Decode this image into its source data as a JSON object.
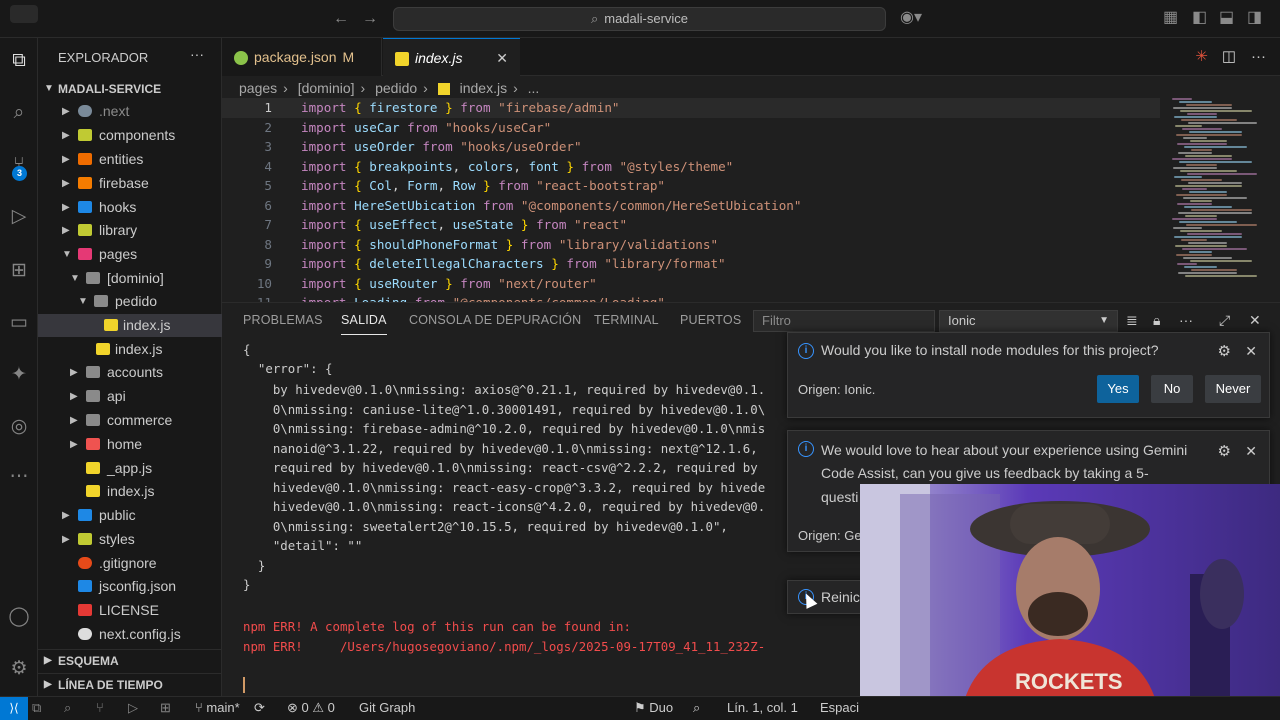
{
  "titlebar": {
    "search_text": "madali-service"
  },
  "activity_bar": {
    "scm_badge": "3"
  },
  "sidebar": {
    "title": "EXPLORADOR",
    "root": "MADALI-SERVICE",
    "items": [
      {
        "label": ".next"
      },
      {
        "label": "components"
      },
      {
        "label": "entities"
      },
      {
        "label": "firebase"
      },
      {
        "label": "hooks"
      },
      {
        "label": "library"
      },
      {
        "label": "pages"
      },
      {
        "label": "[dominio]"
      },
      {
        "label": "pedido"
      },
      {
        "label": "index.js"
      },
      {
        "label": "index.js"
      },
      {
        "label": "accounts"
      },
      {
        "label": "api"
      },
      {
        "label": "commerce"
      },
      {
        "label": "home"
      },
      {
        "label": "_app.js"
      },
      {
        "label": "index.js"
      },
      {
        "label": "public"
      },
      {
        "label": "styles"
      },
      {
        "label": ".gitignore"
      },
      {
        "label": "jsconfig.json"
      },
      {
        "label": "LICENSE"
      },
      {
        "label": "next.config.js"
      }
    ],
    "sections": [
      "ESQUEMA",
      "LÍNEA DE TIEMPO"
    ]
  },
  "tabs": [
    {
      "label": "package.json",
      "modified": "M"
    },
    {
      "label": "index.js"
    }
  ],
  "breadcrumb": [
    "pages",
    "[dominio]",
    "pedido",
    "index.js",
    "..."
  ],
  "editor": {
    "lines": [
      {
        "n": "1",
        "parts": [
          [
            "k",
            "import "
          ],
          [
            "p",
            "{ "
          ],
          [
            "v",
            "firestore"
          ],
          [
            "p",
            " } "
          ],
          [
            "k",
            "from "
          ],
          [
            "s",
            "\"firebase/admin\""
          ]
        ]
      },
      {
        "n": "2",
        "parts": [
          [
            "k",
            "import "
          ],
          [
            "v",
            "useCar "
          ],
          [
            "k",
            "from "
          ],
          [
            "s",
            "\"hooks/useCar\""
          ]
        ]
      },
      {
        "n": "3",
        "parts": [
          [
            "k",
            "import "
          ],
          [
            "v",
            "useOrder "
          ],
          [
            "k",
            "from "
          ],
          [
            "s",
            "\"hooks/useOrder\""
          ]
        ]
      },
      {
        "n": "4",
        "parts": [
          [
            "k",
            "import "
          ],
          [
            "p",
            "{ "
          ],
          [
            "v",
            "breakpoints"
          ],
          [
            "d",
            ", "
          ],
          [
            "v",
            "colors"
          ],
          [
            "d",
            ", "
          ],
          [
            "v",
            "font"
          ],
          [
            "p",
            " } "
          ],
          [
            "k",
            "from "
          ],
          [
            "s",
            "\"@styles/theme\""
          ]
        ]
      },
      {
        "n": "5",
        "parts": [
          [
            "k",
            "import "
          ],
          [
            "p",
            "{ "
          ],
          [
            "v",
            "Col"
          ],
          [
            "d",
            ", "
          ],
          [
            "v",
            "Form"
          ],
          [
            "d",
            ", "
          ],
          [
            "v",
            "Row"
          ],
          [
            "p",
            " } "
          ],
          [
            "k",
            "from "
          ],
          [
            "s",
            "\"react-bootstrap\""
          ]
        ]
      },
      {
        "n": "6",
        "parts": [
          [
            "k",
            "import "
          ],
          [
            "v",
            "HereSetUbication "
          ],
          [
            "k",
            "from "
          ],
          [
            "s",
            "\"@components/common/HereSetUbication\""
          ]
        ]
      },
      {
        "n": "7",
        "parts": [
          [
            "k",
            "import "
          ],
          [
            "p",
            "{ "
          ],
          [
            "v",
            "useEffect"
          ],
          [
            "d",
            ", "
          ],
          [
            "v",
            "useState"
          ],
          [
            "p",
            " } "
          ],
          [
            "k",
            "from "
          ],
          [
            "s",
            "\"react\""
          ]
        ]
      },
      {
        "n": "8",
        "parts": [
          [
            "k",
            "import "
          ],
          [
            "p",
            "{ "
          ],
          [
            "v",
            "shouldPhoneFormat"
          ],
          [
            "p",
            " } "
          ],
          [
            "k",
            "from "
          ],
          [
            "s",
            "\"library/validations\""
          ]
        ]
      },
      {
        "n": "9",
        "parts": [
          [
            "k",
            "import "
          ],
          [
            "p",
            "{ "
          ],
          [
            "v",
            "deleteIllegalCharacters"
          ],
          [
            "p",
            " } "
          ],
          [
            "k",
            "from "
          ],
          [
            "s",
            "\"library/format\""
          ]
        ]
      },
      {
        "n": "10",
        "parts": [
          [
            "k",
            "import "
          ],
          [
            "p",
            "{ "
          ],
          [
            "v",
            "useRouter"
          ],
          [
            "p",
            " } "
          ],
          [
            "k",
            "from "
          ],
          [
            "s",
            "\"next/router\""
          ]
        ]
      },
      {
        "n": "11",
        "parts": [
          [
            "k",
            "import "
          ],
          [
            "v",
            "Loading "
          ],
          [
            "k",
            "from "
          ],
          [
            "s",
            "\"@components/common/Loading\""
          ]
        ]
      }
    ]
  },
  "panel": {
    "tabs": [
      "PROBLEMAS",
      "SALIDA",
      "CONSOLA DE DEPURACIÓN",
      "TERMINAL",
      "PUERTOS"
    ],
    "filter_placeholder": "Filtro",
    "channel": "Ionic",
    "output": [
      "{",
      "  \"error\": {",
      "    by hivedev@0.1.0\\nmissing: axios@^0.21.1, required by hivedev@0.1.",
      "    0\\nmissing: caniuse-lite@^1.0.30001491, required by hivedev@0.1.0\\",
      "    0\\nmissing: firebase-admin@^10.2.0, required by hivedev@0.1.0\\nmis",
      "    nanoid@^3.1.22, required by hivedev@0.1.0\\nmissing: next@^12.1.6,",
      "    required by hivedev@0.1.0\\nmissing: react-csv@^2.2.2, required by",
      "    hivedev@0.1.0\\nmissing: react-easy-crop@^3.3.2, required by hivede",
      "    hivedev@0.1.0\\nmissing: react-icons@^4.2.0, required by hivedev@0.",
      "    0\\nmissing: sweetalert2@^10.15.5, required by hivedev@0.1.0\",",
      "    \"detail\": \"\"",
      "  }",
      "}"
    ],
    "errors": [
      "npm ERR! A complete log of this run can be found in:",
      "npm ERR!     /Users/hugosegoviano/.npm/_logs/2025-09-17T09_41_11_232Z-"
    ]
  },
  "notifications": [
    {
      "message": "Would you like to install node modules for this project?",
      "source": "Origen: Ionic.",
      "buttons": [
        "Yes",
        "No",
        "Never"
      ]
    },
    {
      "message_line1": "We would love to hear about your experience using Gemini",
      "message_line2": "Code Assist, can you give us feedback by taking a 5-",
      "message_line3": "questi",
      "source": "Origen: Ge"
    },
    {
      "message": "Reinic"
    }
  ],
  "statusbar": {
    "branch": "main*",
    "errors": "0",
    "warnings": "0",
    "git_graph": "Git Graph",
    "duo": "Duo",
    "position": "Lín. 1, col. 1",
    "spaces": "Espaci"
  },
  "colors": {
    "accent": "#0078d4",
    "keyword": "#c586c0",
    "string": "#ce9178",
    "variable": "#9cdcfe",
    "error": "#f14c4c"
  }
}
